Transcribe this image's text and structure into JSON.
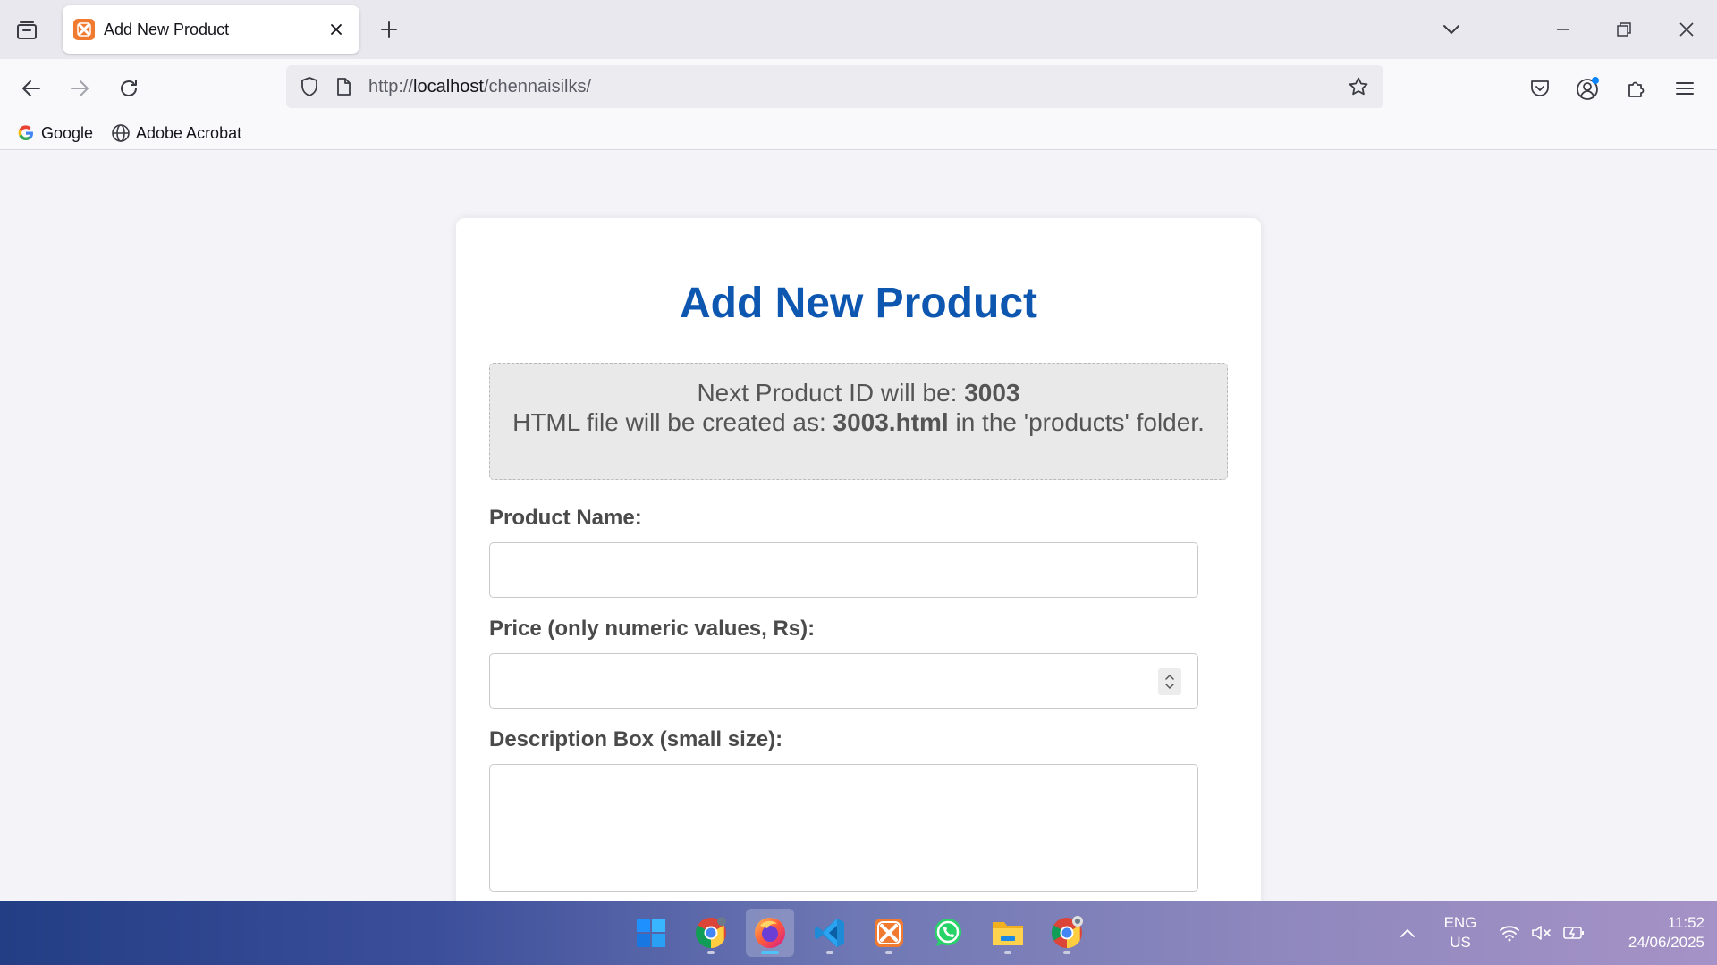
{
  "browser": {
    "tab": {
      "title": "Add New Product"
    },
    "url": {
      "scheme": "http://",
      "host": "localhost",
      "path": "/chennaisilks/"
    },
    "bookmarks": [
      {
        "label": "Google",
        "icon": "google-icon"
      },
      {
        "label": "Adobe Acrobat",
        "icon": "globe-icon"
      }
    ]
  },
  "page": {
    "title": "Add New Product",
    "info": {
      "id_prefix": "Next Product ID will be: ",
      "id_value": "3003",
      "file_prefix": "HTML file will be created as: ",
      "file_value": "3003.html",
      "file_suffix": " in the 'products' folder."
    },
    "form": {
      "name_label": "Product Name:",
      "name_value": "",
      "price_label": "Price (only numeric values, Rs):",
      "price_value": "",
      "desc_label": "Description Box (small size):",
      "desc_value": ""
    }
  },
  "taskbar": {
    "apps": [
      "start-icon",
      "chrome-icon",
      "firefox-icon",
      "vscode-icon",
      "xampp-icon",
      "whatsapp-icon",
      "file-explorer-icon",
      "chrome-canary-icon"
    ],
    "active_app": "firefox-icon",
    "lang_line1": "ENG",
    "lang_line2": "US",
    "time": "11:52",
    "date": "24/06/2025"
  },
  "colors": {
    "title": "#0d57b0",
    "favicon": "#f07a30",
    "tab_background": "#e8e8ee",
    "page_background": "#f4f4f8"
  }
}
